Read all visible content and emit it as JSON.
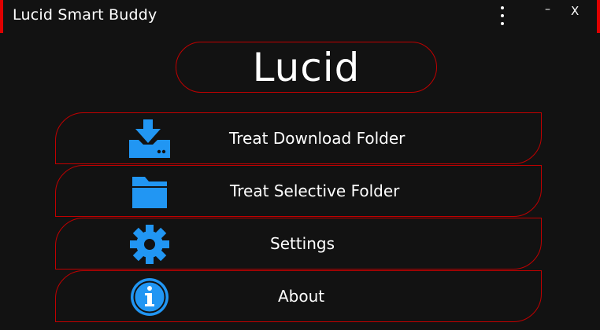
{
  "window": {
    "title": "Lucid Smart Buddy",
    "minimize_label": "–",
    "close_label": "X",
    "menu_icon": "kebab-menu-icon"
  },
  "brand": {
    "name": "Lucid"
  },
  "menu": {
    "items": [
      {
        "label": "Treat Download Folder",
        "icon": "download-icon"
      },
      {
        "label": "Treat Selective Folder",
        "icon": "folder-icon"
      },
      {
        "label": "Settings",
        "icon": "gear-icon"
      },
      {
        "label": "About",
        "icon": "info-icon"
      }
    ]
  },
  "colors": {
    "background": "#121212",
    "accent_border": "#c00000",
    "icon_blue": "#2196f3",
    "text": "#ffffff"
  }
}
